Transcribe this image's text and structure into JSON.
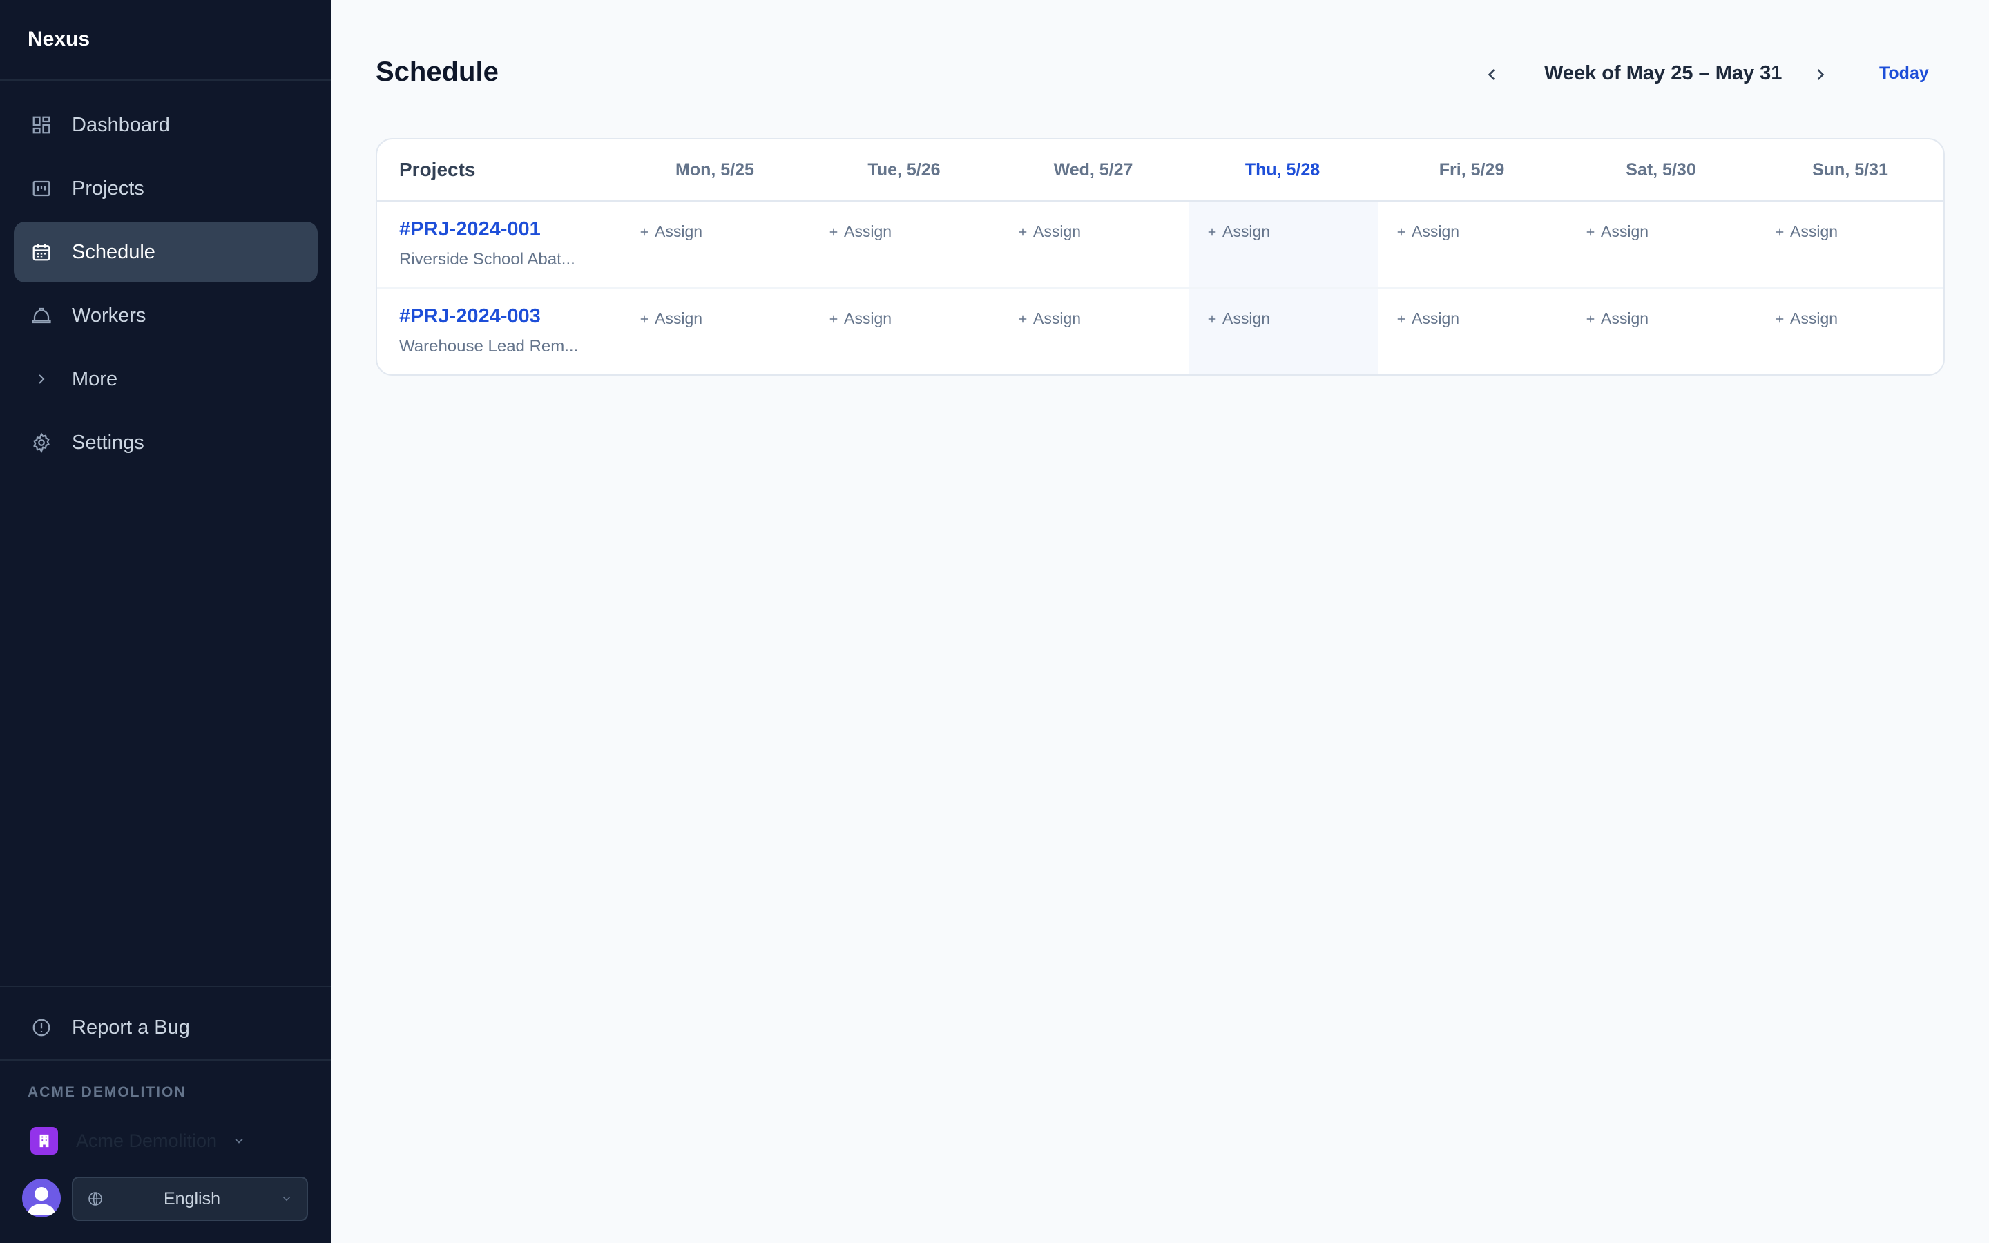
{
  "brand": "Nexus",
  "nav": [
    {
      "label": "Dashboard",
      "icon": "dashboard-icon"
    },
    {
      "label": "Projects",
      "icon": "projects-icon"
    },
    {
      "label": "Schedule",
      "icon": "calendar-icon",
      "active": true
    },
    {
      "label": "Workers",
      "icon": "hardhat-icon"
    },
    {
      "label": "More",
      "icon": "chevron-right-icon"
    },
    {
      "label": "Settings",
      "icon": "gear-icon"
    }
  ],
  "report_bug": "Report a Bug",
  "org": {
    "section_label": "ACME DEMOLITION",
    "name": "Acme Demolition"
  },
  "language": "English",
  "page": {
    "title": "Schedule"
  },
  "week": {
    "label": "Week of May 25 – May 31",
    "today": "Today"
  },
  "grid": {
    "projects_header": "Projects",
    "days": [
      "Mon, 5/25",
      "Tue, 5/26",
      "Wed, 5/27",
      "Thu, 5/28",
      "Fri, 5/29",
      "Sat, 5/30",
      "Sun, 5/31"
    ],
    "today_index": 3,
    "assign_label": "Assign",
    "rows": [
      {
        "id": "#PRJ-2024-001",
        "name": "Riverside School Abat..."
      },
      {
        "id": "#PRJ-2024-003",
        "name": "Warehouse Lead Rem..."
      }
    ]
  },
  "colors": {
    "accent": "#1d4ed8",
    "sidebar_bg": "#0f172a",
    "active_item": "#334155",
    "org_badge": "#9333ea"
  }
}
